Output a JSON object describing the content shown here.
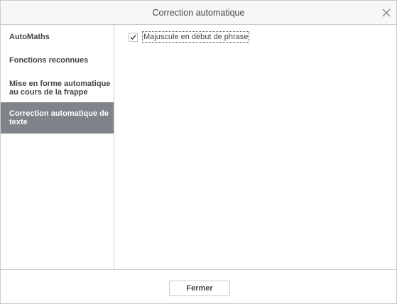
{
  "dialog": {
    "title": "Correction automatique",
    "close_icon": "close-icon"
  },
  "sidebar": {
    "items": [
      {
        "label": "AutoMaths",
        "active": false
      },
      {
        "label": "Fonctions reconnues",
        "active": false
      },
      {
        "label": "Mise en forme automatique au cours de la frappe",
        "active": false
      },
      {
        "label": "Correction automatique de texte",
        "active": true
      }
    ],
    "active_bg": "#7e848a"
  },
  "content": {
    "options": [
      {
        "label": "Majuscule en début de phrase",
        "checked": true,
        "icon": "checkmark-icon"
      }
    ]
  },
  "footer": {
    "close_label": "Fermer"
  }
}
